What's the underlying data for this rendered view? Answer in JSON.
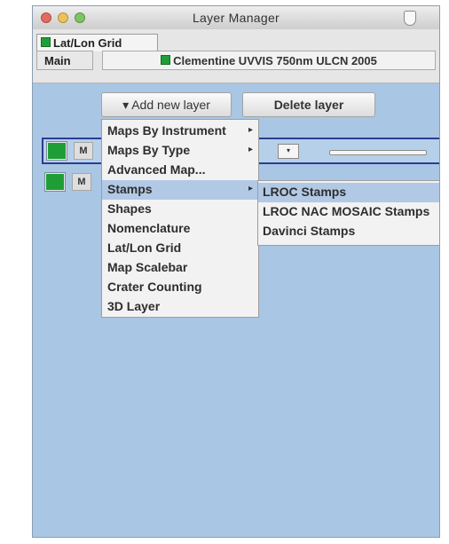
{
  "window": {
    "title": "Layer Manager"
  },
  "tabs": {
    "top_tab": "Lat/Lon Grid",
    "main_tab": "Main",
    "clementine_tab": "Clementine UVVIS 750nm ULCN 2005"
  },
  "toolbar": {
    "add_label": "▾ Add new layer",
    "delete_label": "Delete layer"
  },
  "layers": [
    {
      "visible_color": "#1f9e37",
      "m_label": "M",
      "selected": true
    },
    {
      "visible_color": "#1f9e37",
      "m_label": "M",
      "selected": false
    }
  ],
  "add_menu": {
    "items": [
      {
        "label": "Maps By Instrument",
        "has_submenu": true
      },
      {
        "label": "Maps By Type",
        "has_submenu": true
      },
      {
        "label": "Advanced Map...",
        "has_submenu": false
      },
      {
        "label": "Stamps",
        "has_submenu": true,
        "highlighted": true
      },
      {
        "label": "Shapes",
        "has_submenu": false
      },
      {
        "label": "Nomenclature",
        "has_submenu": false
      },
      {
        "label": "Lat/Lon Grid",
        "has_submenu": false
      },
      {
        "label": "Map Scalebar",
        "has_submenu": false
      },
      {
        "label": "Crater Counting",
        "has_submenu": false
      },
      {
        "label": "3D Layer",
        "has_submenu": false
      }
    ]
  },
  "stamps_submenu": {
    "items": [
      {
        "label": "LROC Stamps",
        "highlighted": true
      },
      {
        "label": "LROC NAC MOSAIC Stamps"
      },
      {
        "label": "Davinci Stamps"
      }
    ]
  },
  "icons": {
    "arrow": "▸",
    "dropdown": "▾"
  },
  "colors": {
    "panel": "#a9c6e4",
    "highlight": "#b2c9e6",
    "selected_border": "#2a3d8f",
    "layer_green": "#1f9e37"
  }
}
